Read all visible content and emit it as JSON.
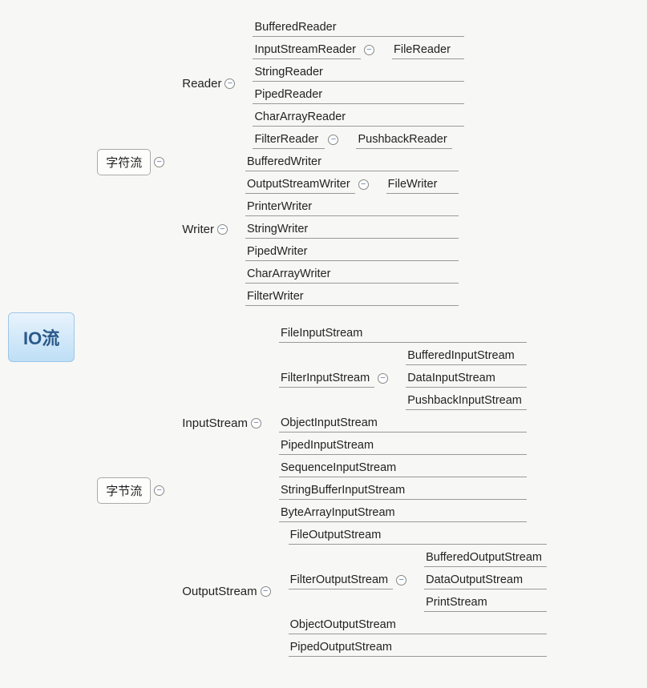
{
  "root": "IO流",
  "charStream": {
    "label": "字符流",
    "reader": {
      "label": "Reader",
      "items": [
        "BufferedReader",
        "InputStreamReader",
        "StringReader",
        "PipedReader",
        "CharArrayReader",
        "FilterReader"
      ],
      "inputStreamReader_child": "FileReader",
      "filterReader_child": "PushbackReader"
    },
    "writer": {
      "label": "Writer",
      "items": [
        "BufferedWriter",
        "OutputStreamWriter",
        "PrinterWriter",
        "StringWriter",
        "PipedWriter",
        "CharArrayWriter",
        "FilterWriter"
      ],
      "outputStreamWriter_child": "FileWriter"
    }
  },
  "byteStream": {
    "label": "字节流",
    "inputStream": {
      "label": "InputStream",
      "items": [
        "FileInputStream",
        "FilterInputStream",
        "ObjectInputStream",
        "PipedInputStream",
        "SequenceInputStream",
        "StringBufferInputStream",
        "ByteArrayInputStream"
      ],
      "filterInputStream_children": [
        "BufferedInputStream",
        "DataInputStream",
        "PushbackInputStream"
      ]
    },
    "outputStream": {
      "label": "OutputStream",
      "items": [
        "FileOutputStream",
        "FilterOutputStream",
        "ObjectOutputStream",
        "PipedOutputStream"
      ],
      "filterOutputStream_children": [
        "BufferedOutputStream",
        "DataOutputStream",
        "PrintStream"
      ]
    }
  }
}
